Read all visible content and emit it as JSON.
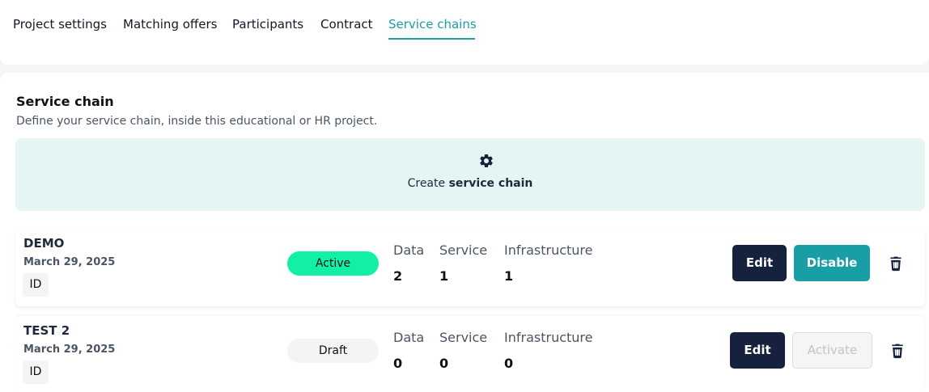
{
  "tabs": [
    {
      "label": "Project settings"
    },
    {
      "label": "Matching offers"
    },
    {
      "label": "Participants"
    },
    {
      "label": "Contract"
    },
    {
      "label": "Service chains"
    }
  ],
  "section": {
    "title": "Service chain",
    "description": "Define your service chain, inside this educational or HR project."
  },
  "create": {
    "prefix": "Create",
    "bold": "service chain",
    "icon": "gear-icon"
  },
  "chains": [
    {
      "name": "DEMO",
      "date": "March 29, 2025",
      "id_label": "ID",
      "status": "Active",
      "columns": [
        {
          "label": "Data",
          "value": "2"
        },
        {
          "label": "Service",
          "value": "1"
        },
        {
          "label": "Infrastructure",
          "value": "1"
        }
      ],
      "edit_label": "Edit",
      "toggle_label": "Disable"
    },
    {
      "name": "TEST 2",
      "date": "March 29, 2025",
      "id_label": "ID",
      "status": "Draft",
      "columns": [
        {
          "label": "Data",
          "value": "0"
        },
        {
          "label": "Service",
          "value": "0"
        },
        {
          "label": "Infrastructure",
          "value": "0"
        }
      ],
      "edit_label": "Edit",
      "toggle_label": "Activate"
    }
  ],
  "colors": {
    "accent": "#1a9ea6",
    "dark_button": "#16213e",
    "active_status": "#12f0a6",
    "create_bg": "#e5f5f4"
  }
}
